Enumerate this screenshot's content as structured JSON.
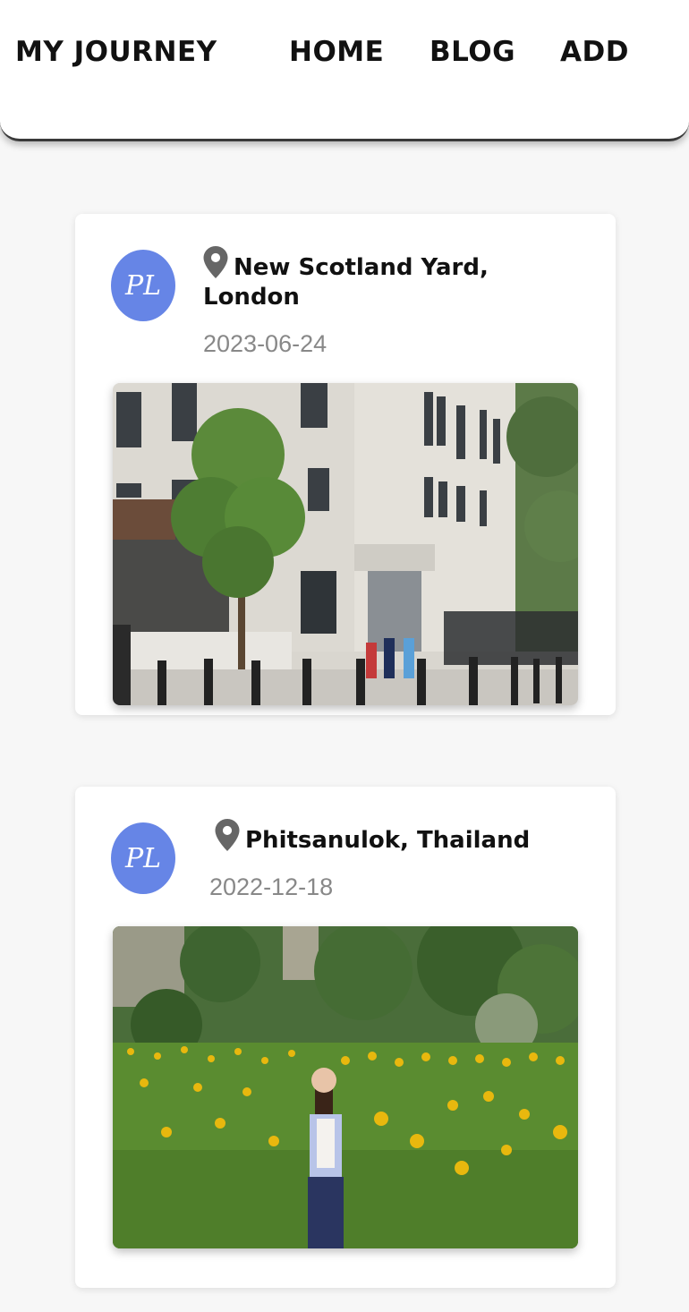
{
  "header": {
    "brand": "MY JOURNEY",
    "nav": [
      "HOME",
      "BLOG",
      "ADD"
    ]
  },
  "posts": [
    {
      "avatar_initials": "PL",
      "location": "New Scotland Yard, London",
      "date": "2023-06-24",
      "image_icon": "building-photo"
    },
    {
      "avatar_initials": "PL",
      "location": "Phitsanulok, Thailand",
      "date": "2022-12-18",
      "image_icon": "sunflower-field-photo"
    }
  ],
  "colors": {
    "avatar": "#6685e6",
    "date": "#888888",
    "pin": "#666666"
  }
}
